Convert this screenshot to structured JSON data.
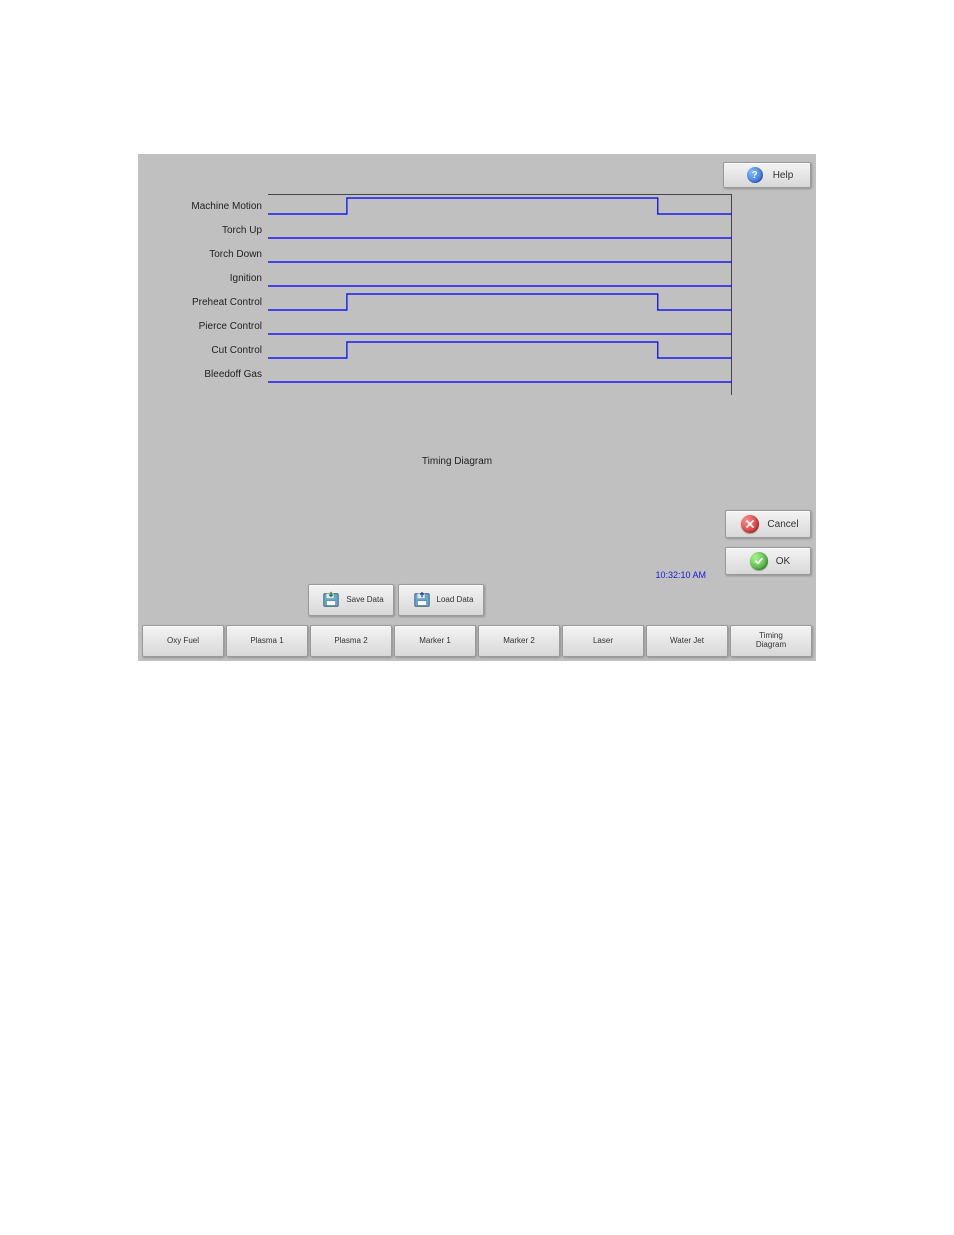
{
  "header": {
    "help_label": "Help"
  },
  "actions": {
    "cancel_label": "Cancel",
    "ok_label": "OK"
  },
  "data_buttons": {
    "save_label": "Save Data",
    "load_label": "Load Data"
  },
  "timestamp": "10:32:10 AM",
  "diagram": {
    "title": "Timing Diagram",
    "signals": [
      {
        "label": "Machine Motion",
        "shape": "pulse"
      },
      {
        "label": "Torch Up",
        "shape": "low"
      },
      {
        "label": "Torch Down",
        "shape": "low"
      },
      {
        "label": "Ignition",
        "shape": "low"
      },
      {
        "label": "Preheat Control",
        "shape": "pulse"
      },
      {
        "label": "Pierce Control",
        "shape": "low"
      },
      {
        "label": "Cut Control",
        "shape": "pulse"
      },
      {
        "label": "Bleedoff Gas",
        "shape": "low"
      }
    ]
  },
  "tabs": [
    "Oxy Fuel",
    "Plasma 1",
    "Plasma 2",
    "Marker 1",
    "Marker 2",
    "Laser",
    "Water Jet",
    "Timing Diagram"
  ],
  "chart_data": {
    "type": "line",
    "title": "Timing Diagram",
    "xlabel": "",
    "ylabel": "",
    "x": [
      0,
      0.17,
      0.84,
      1.0
    ],
    "series": [
      {
        "name": "Machine Motion",
        "values": [
          0,
          1,
          1,
          0
        ]
      },
      {
        "name": "Torch Up",
        "values": [
          0,
          0,
          0,
          0
        ]
      },
      {
        "name": "Torch Down",
        "values": [
          0,
          0,
          0,
          0
        ]
      },
      {
        "name": "Ignition",
        "values": [
          0,
          0,
          0,
          0
        ]
      },
      {
        "name": "Preheat Control",
        "values": [
          0,
          1,
          1,
          0
        ]
      },
      {
        "name": "Pierce Control",
        "values": [
          0,
          0,
          0,
          0
        ]
      },
      {
        "name": "Cut Control",
        "values": [
          0,
          1,
          1,
          0
        ]
      },
      {
        "name": "Bleedoff Gas",
        "values": [
          0,
          0,
          0,
          0
        ]
      }
    ]
  }
}
